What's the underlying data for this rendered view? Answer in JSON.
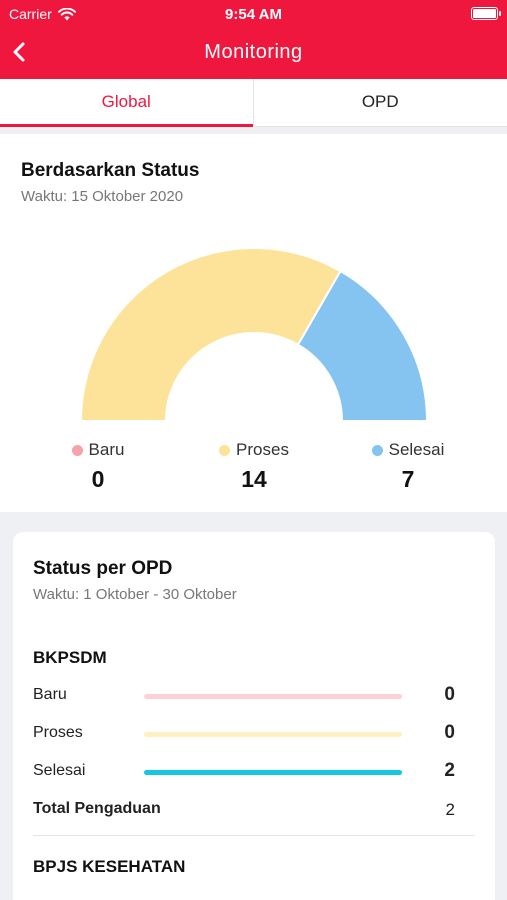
{
  "status_bar": {
    "carrier": "Carrier",
    "time": "9:54 AM"
  },
  "nav": {
    "title": "Monitoring",
    "back_icon": "chevron-left-icon"
  },
  "tabs": [
    {
      "label": "Global",
      "active": true
    },
    {
      "label": "OPD",
      "active": false
    }
  ],
  "status_card": {
    "title": "Berdasarkan Status",
    "date": "Waktu: 15 Oktober 2020",
    "legend": [
      {
        "label": "Baru",
        "value": "0",
        "color": "#f4a3ad"
      },
      {
        "label": "Proses",
        "value": "14",
        "color": "#fde39a"
      },
      {
        "label": "Selesai",
        "value": "7",
        "color": "#85c3f0"
      }
    ]
  },
  "opd_card": {
    "title": "Status per OPD",
    "date": "Waktu: 1 Oktober - 30 Oktober",
    "groups": [
      {
        "name": "BKPSDM",
        "rows": [
          {
            "label": "Baru",
            "value": "0",
            "fraction": 0.0,
            "color": "#fbd1d6"
          },
          {
            "label": "Proses",
            "value": "0",
            "fraction": 0.0,
            "color": "#fdf1c2"
          },
          {
            "label": "Selesai",
            "value": "2",
            "fraction": 1.0,
            "color": "#17c6e0"
          }
        ],
        "total_label": "Total Pengaduan",
        "total_value": "2"
      },
      {
        "name": "BPJS KESEHATAN"
      }
    ]
  },
  "colors": {
    "brand": "#f0173f",
    "accent": "#17c6e0"
  }
}
